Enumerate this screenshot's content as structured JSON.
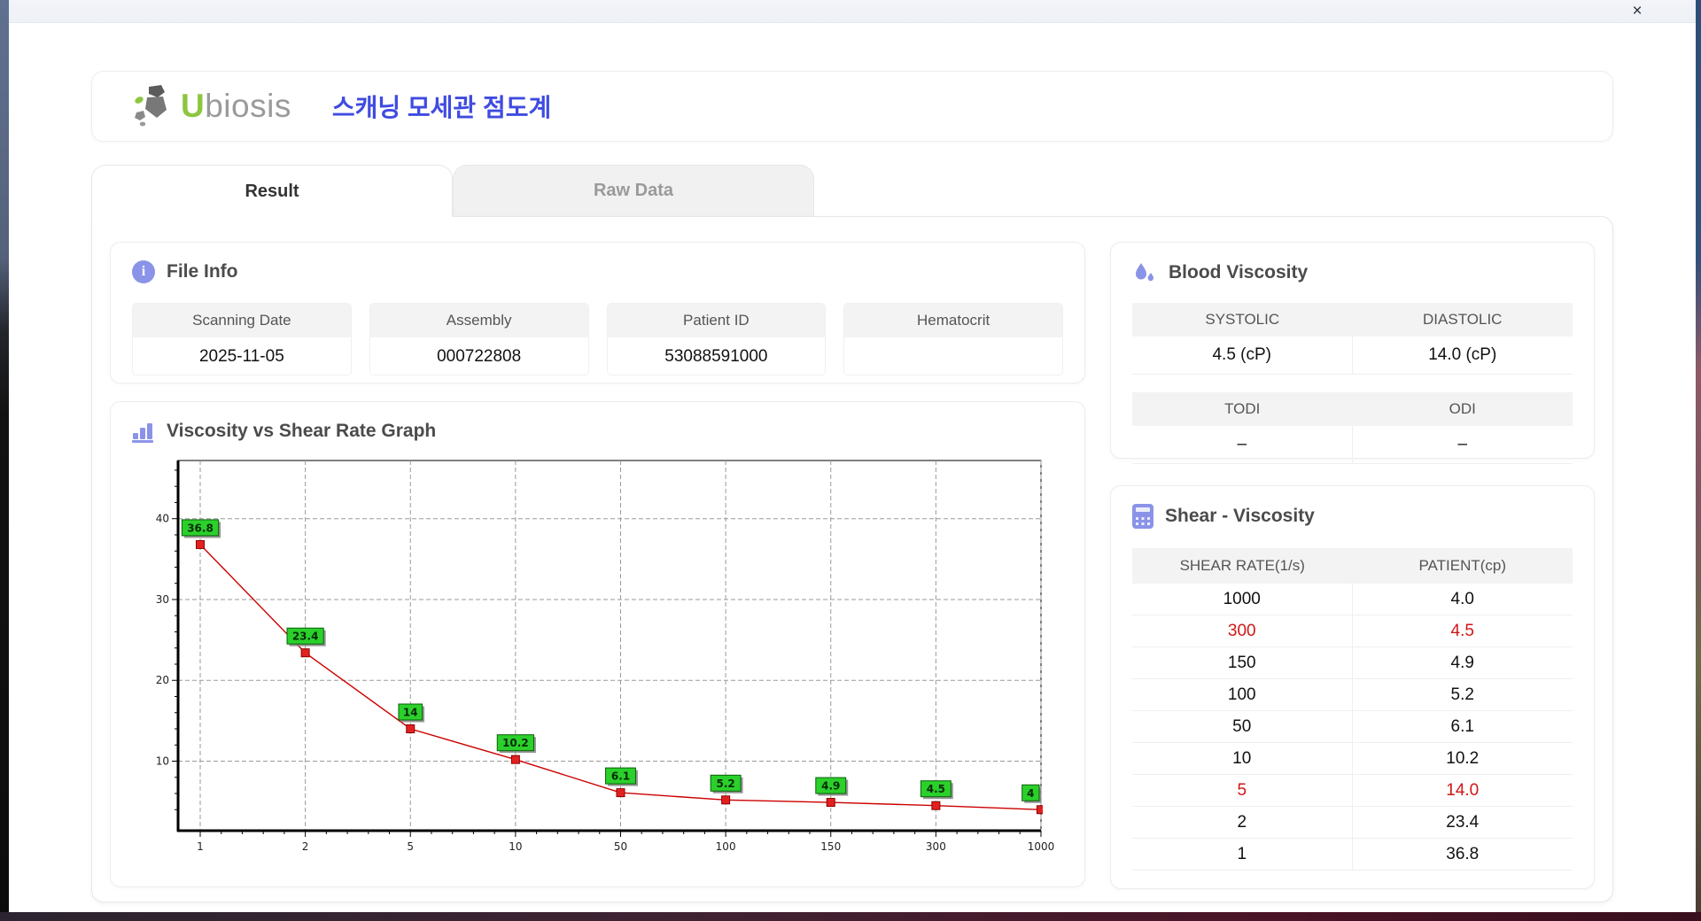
{
  "window": {
    "close_label": "×"
  },
  "header": {
    "logo_first_letter": "U",
    "logo_rest": "biosis",
    "app_title": "스캐닝 모세관 점도계"
  },
  "tabs": [
    {
      "label": "Result",
      "active": true
    },
    {
      "label": "Raw Data",
      "active": false
    }
  ],
  "file_info": {
    "title": "File Info",
    "fields": [
      {
        "label": "Scanning Date",
        "value": "2025-11-05"
      },
      {
        "label": "Assembly",
        "value": "000722808"
      },
      {
        "label": "Patient ID",
        "value": "53088591000"
      },
      {
        "label": "Hematocrit",
        "value": ""
      }
    ]
  },
  "blood_viscosity": {
    "title": "Blood Viscosity",
    "groups": [
      {
        "cells": [
          {
            "label": "SYSTOLIC",
            "value": "4.5 (cP)"
          },
          {
            "label": "DIASTOLIC",
            "value": "14.0 (cP)"
          }
        ]
      },
      {
        "cells": [
          {
            "label": "TODI",
            "value": "–"
          },
          {
            "label": "ODI",
            "value": "–"
          }
        ]
      }
    ]
  },
  "shear_viscosity": {
    "title": "Shear - Viscosity",
    "columns": [
      "SHEAR RATE(1/s)",
      "PATIENT(cp)"
    ],
    "rows": [
      {
        "shear": "1000",
        "patient": "4.0",
        "highlight": false
      },
      {
        "shear": "300",
        "patient": "4.5",
        "highlight": true
      },
      {
        "shear": "150",
        "patient": "4.9",
        "highlight": false
      },
      {
        "shear": "100",
        "patient": "5.2",
        "highlight": false
      },
      {
        "shear": "50",
        "patient": "6.1",
        "highlight": false
      },
      {
        "shear": "10",
        "patient": "10.2",
        "highlight": false
      },
      {
        "shear": "5",
        "patient": "14.0",
        "highlight": true
      },
      {
        "shear": "2",
        "patient": "23.4",
        "highlight": false
      },
      {
        "shear": "1",
        "patient": "36.8",
        "highlight": false
      }
    ]
  },
  "chart_data": {
    "type": "line",
    "title": "Viscosity vs Shear Rate Graph",
    "xlabel": "",
    "ylabel": "",
    "x": [
      1,
      2,
      5,
      10,
      50,
      100,
      150,
      300,
      1000
    ],
    "y": [
      36.8,
      23.4,
      14.0,
      10.2,
      6.1,
      5.2,
      4.9,
      4.5,
      4.0
    ],
    "point_labels": [
      "36.8",
      "23.4",
      "14",
      "10.2",
      "6.1",
      "5.2",
      "4.9",
      "4.5",
      "4"
    ],
    "x_tick_labels": [
      "1",
      "2",
      "5",
      "10",
      "50",
      "100",
      "150",
      "300",
      "1000"
    ],
    "y_ticks": [
      10,
      20,
      30,
      40
    ],
    "ylim": [
      1.4,
      47.2
    ],
    "grid": true,
    "legend": "none",
    "line_color": "#cc0000",
    "marker_color": "#e32020",
    "marker_edge_color": "#8c0000",
    "label_bg": "#2bd02b",
    "label_border": "#0a600a",
    "label_text_color": "#072b07",
    "grid_color": "#9a9a9a"
  }
}
